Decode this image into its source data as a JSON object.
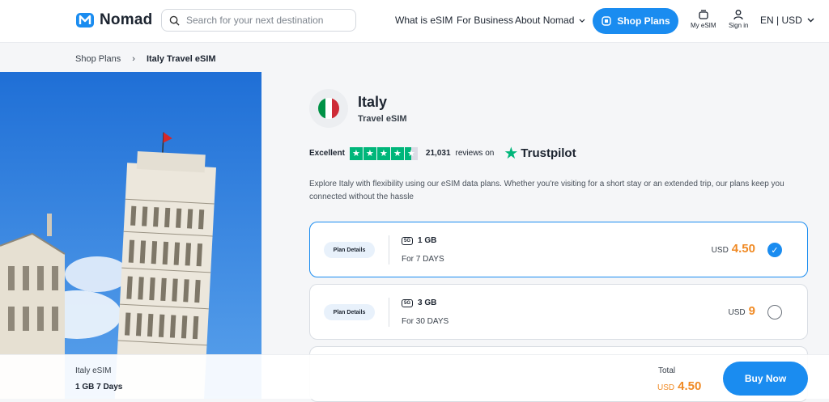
{
  "header": {
    "brand": "Nomad",
    "search_placeholder": "Search for your next destination",
    "nav": [
      "What is eSIM",
      "For Business",
      "About Nomad"
    ],
    "shop_plans": "Shop Plans",
    "my_esim": "My eSIM",
    "sign_in": "Sign in",
    "locale": "EN | USD"
  },
  "breadcrumb": {
    "parent": "Shop Plans",
    "current": "Italy Travel eSIM"
  },
  "product": {
    "country": "Italy",
    "subtitle": "Travel eSIM",
    "flag_colors": [
      "#009246",
      "#ffffff",
      "#ce2b37"
    ]
  },
  "rating": {
    "label": "Excellent",
    "stars": 4.5,
    "reviews": "21,031",
    "reviews_suffix": "reviews on",
    "provider": "Trustpilot"
  },
  "description": "Explore Italy with flexibility using our eSIM data plans. Whether you're visiting for a short stay or an extended trip, our plans keep you connected without the hassle",
  "plans": [
    {
      "details": "Plan Details",
      "network": "5G",
      "data": "1 GB",
      "duration": "For 7 DAYS",
      "currency": "USD",
      "price": "4.50",
      "selected": true
    },
    {
      "details": "Plan Details",
      "network": "5G",
      "data": "3 GB",
      "duration": "For 30 DAYS",
      "currency": "USD",
      "price": "9",
      "selected": false
    }
  ],
  "summary": {
    "title": "Italy eSIM",
    "plan": "1 GB 7 Days",
    "total_label": "Total",
    "currency": "USD",
    "amount": "4.50",
    "buy": "Buy Now"
  },
  "colors": {
    "accent": "#1a8cf0",
    "price": "#f08a24",
    "trustpilot": "#00b67a"
  }
}
